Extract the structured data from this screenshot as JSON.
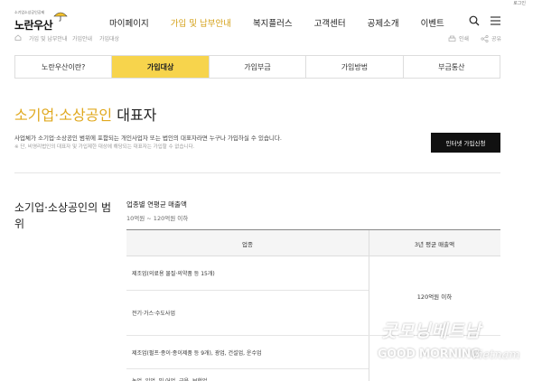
{
  "header": {
    "logo_sub": "소기업소상공인공제",
    "logo_main": "노란우산",
    "top_right_link": "로그인",
    "nav": [
      {
        "label": "마이페이지",
        "active": false
      },
      {
        "label": "가입 및 납부안내",
        "active": true
      },
      {
        "label": "복지플러스",
        "active": false
      },
      {
        "label": "고객센터",
        "active": false
      },
      {
        "label": "공제소개",
        "active": false
      },
      {
        "label": "이벤트",
        "active": false
      }
    ],
    "search_icon": "search-icon",
    "menu_icon": "hamburger-menu-icon"
  },
  "breadcrumb": {
    "items": [
      "가입 및 납부안내",
      "가입안내",
      "가입대상"
    ],
    "print_label": "인쇄",
    "share_label": "공유"
  },
  "tabs": [
    {
      "label": "노란우산이란?",
      "active": false
    },
    {
      "label": "가입대상",
      "active": true
    },
    {
      "label": "가입부금",
      "active": false
    },
    {
      "label": "가입방법",
      "active": false
    },
    {
      "label": "부금통산",
      "active": false
    }
  ],
  "page": {
    "title_highlight": "소기업·소상공인",
    "title_rest": " 대표자",
    "desc_main": "사업체가 소기업·소상공인 범위에 포함되는 개인사업자 또는 법인의 대표자라면 누구나 가입하실 수 있습니다.",
    "desc_note": "※ 단, 비영리법인의 대표자 및 가입제한 대상에 해당되는 대표자는 가입할 수 없습니다.",
    "apply_button": "인터넷 가입신청"
  },
  "section": {
    "title": "소기업·소상공인의 범위",
    "criteria_label": "업종별 연평균 매출액",
    "criteria_value": "10억원 ~ 120억원 이하",
    "table": {
      "headers": [
        "업종",
        "3년 평균 매출액"
      ],
      "rows": [
        "제조업(의료용 물질·의약품 등 15개)",
        "전기·가스·수도사업",
        "제조업(펄프·종이·종이제품 등 9개), 광업, 건설업, 운수업",
        "농업, 임업, 및 어업, 금융, 보험업"
      ],
      "merged_value": "120억원 이하"
    }
  },
  "watermark": {
    "korean": "굿모닝베트남",
    "english": "GOOD MORNING",
    "vietnam": "Vietnam"
  },
  "colors": {
    "accent_yellow": "#f7d44c",
    "title_highlight": "#e0a81e",
    "active_nav": "#d4a017",
    "button_bg": "#111111"
  }
}
